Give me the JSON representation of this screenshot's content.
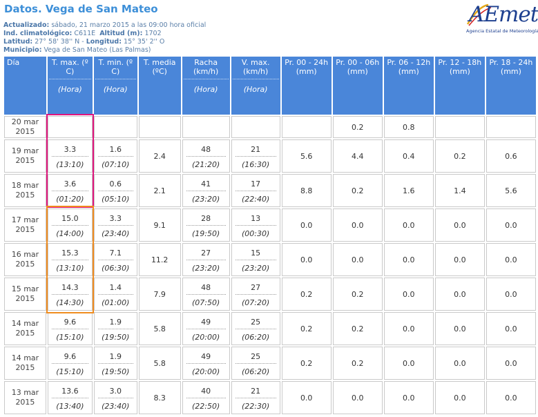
{
  "header": {
    "title": "Datos. Vega de San Mateo",
    "updated_label": "Actualizado:",
    "updated_value": "sábado, 21 marzo 2015 a las 09:00 hora oficial",
    "ind_label": "Ind. climatológico:",
    "ind_value": "C611E",
    "alt_label": "Altitud (m):",
    "alt_value": "1702",
    "lat_label": "Latitud:",
    "lat_value": "27° 58' 38'' N",
    "lon_label": "Longitud:",
    "lon_value": "15° 35' 2'' O",
    "mun_label": "Municipio:",
    "mun_value": "Vega de San Mateo (Las Palmas)"
  },
  "logo": {
    "word": "AEmet",
    "subtitle": "Agencia Estatal de Meteorología",
    "colors": [
      "#1d3f8f",
      "#e5a818",
      "#d42020"
    ]
  },
  "table": {
    "columns": [
      {
        "label": "Día",
        "unit": "",
        "hora": ""
      },
      {
        "label": "T. max. (º C)",
        "unit": "",
        "hora": "(Hora)"
      },
      {
        "label": "T. min. (º C)",
        "unit": "",
        "hora": "(Hora)"
      },
      {
        "label": "T. media (ºC)",
        "unit": "",
        "hora": ""
      },
      {
        "label": "Racha",
        "unit": "(km/h)",
        "hora": "(Hora)"
      },
      {
        "label": "V. max.",
        "unit": "(km/h)",
        "hora": "(Hora)"
      },
      {
        "label": "Pr. 00 - 24h",
        "unit": "(mm)",
        "hora": ""
      },
      {
        "label": "Pr. 00 - 06h",
        "unit": "(mm)",
        "hora": ""
      },
      {
        "label": "Pr. 06 - 12h",
        "unit": "(mm)",
        "hora": ""
      },
      {
        "label": "Pr. 12 - 18h",
        "unit": "(mm)",
        "hora": ""
      },
      {
        "label": "Pr. 18 - 24h",
        "unit": "(mm)",
        "hora": ""
      }
    ],
    "rows": [
      {
        "day": "20 mar 2015",
        "tmax": "",
        "tmax_h": "",
        "tmin": "",
        "tmin_h": "",
        "tmed": "",
        "racha": "",
        "racha_h": "",
        "vmax": "",
        "vmax_h": "",
        "pr24": "",
        "pr06": "0.2",
        "pr612": "0.8",
        "pr1218": "",
        "pr1824": ""
      },
      {
        "day": "19 mar 2015",
        "tmax": "3.3",
        "tmax_h": "(13:10)",
        "tmin": "1.6",
        "tmin_h": "(07:10)",
        "tmed": "2.4",
        "racha": "48",
        "racha_h": "(21:20)",
        "vmax": "21",
        "vmax_h": "(16:30)",
        "pr24": "5.6",
        "pr06": "4.4",
        "pr612": "0.4",
        "pr1218": "0.2",
        "pr1824": "0.6"
      },
      {
        "day": "18 mar 2015",
        "tmax": "3.6",
        "tmax_h": "(01:20)",
        "tmin": "0.6",
        "tmin_h": "(05:10)",
        "tmed": "2.1",
        "racha": "41",
        "racha_h": "(23:20)",
        "vmax": "17",
        "vmax_h": "(22:40)",
        "pr24": "8.8",
        "pr06": "0.2",
        "pr612": "1.6",
        "pr1218": "1.4",
        "pr1824": "5.6"
      },
      {
        "day": "17 mar 2015",
        "tmax": "15.0",
        "tmax_h": "(14:00)",
        "tmin": "3.3",
        "tmin_h": "(23:40)",
        "tmed": "9.1",
        "racha": "28",
        "racha_h": "(19:50)",
        "vmax": "13",
        "vmax_h": "(00:30)",
        "pr24": "0.0",
        "pr06": "0.0",
        "pr612": "0.0",
        "pr1218": "0.0",
        "pr1824": "0.0"
      },
      {
        "day": "16 mar 2015",
        "tmax": "15.3",
        "tmax_h": "(13:10)",
        "tmin": "7.1",
        "tmin_h": "(06:30)",
        "tmed": "11.2",
        "racha": "27",
        "racha_h": "(23:20)",
        "vmax": "15",
        "vmax_h": "(23:20)",
        "pr24": "0.0",
        "pr06": "0.0",
        "pr612": "0.0",
        "pr1218": "0.0",
        "pr1824": "0.0"
      },
      {
        "day": "15 mar 2015",
        "tmax": "14.3",
        "tmax_h": "(14:30)",
        "tmin": "1.4",
        "tmin_h": "(01:00)",
        "tmed": "7.9",
        "racha": "48",
        "racha_h": "(07:50)",
        "vmax": "27",
        "vmax_h": "(07:20)",
        "pr24": "0.2",
        "pr06": "0.2",
        "pr612": "0.0",
        "pr1218": "0.0",
        "pr1824": "0.0"
      },
      {
        "day": "14 mar 2015",
        "tmax": "9.6",
        "tmax_h": "(15:10)",
        "tmin": "1.9",
        "tmin_h": "(19:50)",
        "tmed": "5.8",
        "racha": "49",
        "racha_h": "(20:00)",
        "vmax": "25",
        "vmax_h": "(06:20)",
        "pr24": "0.2",
        "pr06": "0.2",
        "pr612": "0.0",
        "pr1218": "0.0",
        "pr1824": "0.0"
      },
      {
        "day": "14 mar 2015",
        "tmax": "9.6",
        "tmax_h": "(15:10)",
        "tmin": "1.9",
        "tmin_h": "(19:50)",
        "tmed": "5.8",
        "racha": "49",
        "racha_h": "(20:00)",
        "vmax": "25",
        "vmax_h": "(06:20)",
        "pr24": "0.2",
        "pr06": "0.2",
        "pr612": "0.0",
        "pr1218": "0.0",
        "pr1824": "0.0"
      },
      {
        "day": "13 mar 2015",
        "tmax": "13.6",
        "tmax_h": "(13:40)",
        "tmin": "3.0",
        "tmin_h": "(23:40)",
        "tmed": "8.3",
        "racha": "40",
        "racha_h": "(22:50)",
        "vmax": "21",
        "vmax_h": "(22:30)",
        "pr24": "0.0",
        "pr06": "0.0",
        "pr612": "0.0",
        "pr1218": "0.0",
        "pr1824": "0.0"
      }
    ]
  },
  "highlights": {
    "magenta": "#e0157d",
    "orange": "#f08c1e"
  }
}
